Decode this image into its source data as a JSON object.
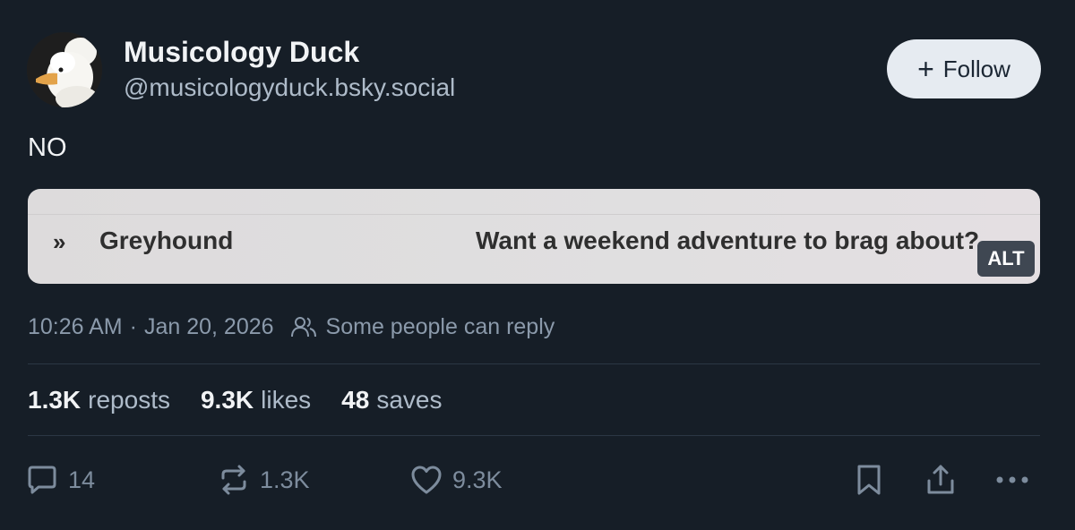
{
  "author": {
    "display_name": "Musicology Duck",
    "handle": "@musicologyduck.bsky.social",
    "avatar_icon": "duck-avatar"
  },
  "follow_button": {
    "label": "Follow",
    "icon": "plus-icon"
  },
  "post": {
    "text": "NO",
    "embed": {
      "chevron": "»",
      "brand": "Greyhound",
      "tagline": "Want a weekend adventure to brag about?",
      "alt_badge": "ALT"
    },
    "time": "10:26 AM",
    "separator": "·",
    "date": "Jan 20, 2026",
    "reply_setting": "Some people can reply"
  },
  "stats": {
    "reposts_count": "1.3K",
    "reposts_label": "reposts",
    "likes_count": "9.3K",
    "likes_label": "likes",
    "saves_count": "48",
    "saves_label": "saves"
  },
  "actions": {
    "reply_count": "14",
    "repost_count": "1.3K",
    "like_count": "9.3K"
  },
  "colors": {
    "background": "#161e27",
    "primary_text": "#f1f3f5",
    "secondary_text": "#aebbc9",
    "muted_icon": "#7d8c9d",
    "follow_bg": "#e6ebf1"
  }
}
